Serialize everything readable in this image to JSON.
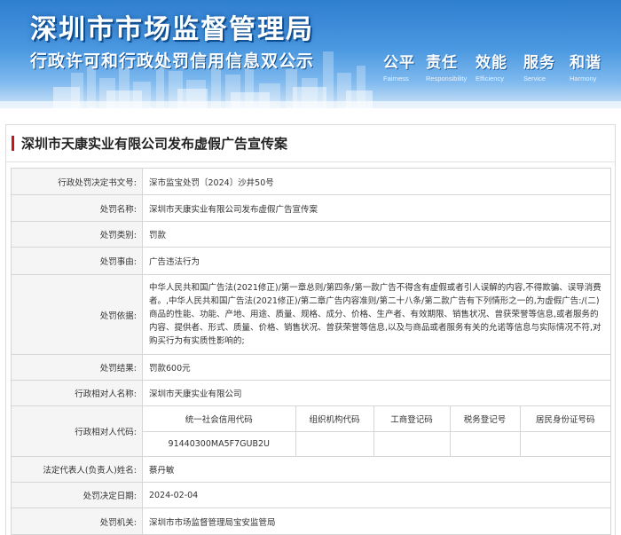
{
  "banner": {
    "title": "深圳市市场监督管理局",
    "subtitle": "行政许可和行政处罚信用信息双公示",
    "slogans": [
      {
        "cn": "公平",
        "en": "Fairness"
      },
      {
        "cn": "责任",
        "en": "Responsibility"
      },
      {
        "cn": "效能",
        "en": "Efficiency"
      },
      {
        "cn": "服务",
        "en": "Service"
      },
      {
        "cn": "和谐",
        "en": "Harmony"
      }
    ]
  },
  "page": {
    "title": "深圳市天康实业有限公司发布虚假广告宣传案"
  },
  "info": {
    "decision_no": {
      "label": "行政处罚决定书文号:",
      "value": "深市监宝处罚〔2024〕沙井50号"
    },
    "case_name": {
      "label": "处罚名称:",
      "value": "深圳市天康实业有限公司发布虚假广告宣传案"
    },
    "category": {
      "label": "处罚类别:",
      "value": "罚款"
    },
    "reason": {
      "label": "处罚事由:",
      "value": "广告违法行为"
    },
    "basis": {
      "label": "处罚依据:",
      "value": "中华人民共和国广告法(2021修正)/第一章总则/第四条/第一款广告不得含有虚假或者引人误解的内容,不得欺骗、误导消费者。,中华人民共和国广告法(2021修正)/第二章广告内容准则/第二十八条/第二款广告有下列情形之一的,为虚假广告:/(二)商品的性能、功能、产地、用途、质量、规格、成分、价格、生产者、有效期限、销售状况、曾获荣誉等信息,或者服务的内容、提供者、形式、质量、价格、销售状况、曾获荣誉等信息,以及与商品或者服务有关的允诺等信息与实际情况不符,对购买行为有实质性影响的;"
    },
    "result": {
      "label": "处罚结果:",
      "value": "罚款600元"
    },
    "party_name": {
      "label": "行政相对人名称:",
      "value": "深圳市天康实业有限公司"
    },
    "party_code": {
      "label": "行政相对人代码:",
      "headers": [
        "统一社会信用代码",
        "组织机构代码",
        "工商登记码",
        "税务登记号",
        "居民身份证号码"
      ],
      "values": [
        "91440300MA5F7GUB2U",
        "",
        "",
        "",
        ""
      ]
    },
    "legal_rep": {
      "label": "法定代表人(负责人)姓名:",
      "value": "蔡丹敏"
    },
    "decision_date": {
      "label": "处罚决定日期:",
      "value": "2024-02-04"
    },
    "authority": {
      "label": "处罚机关:",
      "value": "深圳市市场监督管理局宝安监管局"
    }
  }
}
